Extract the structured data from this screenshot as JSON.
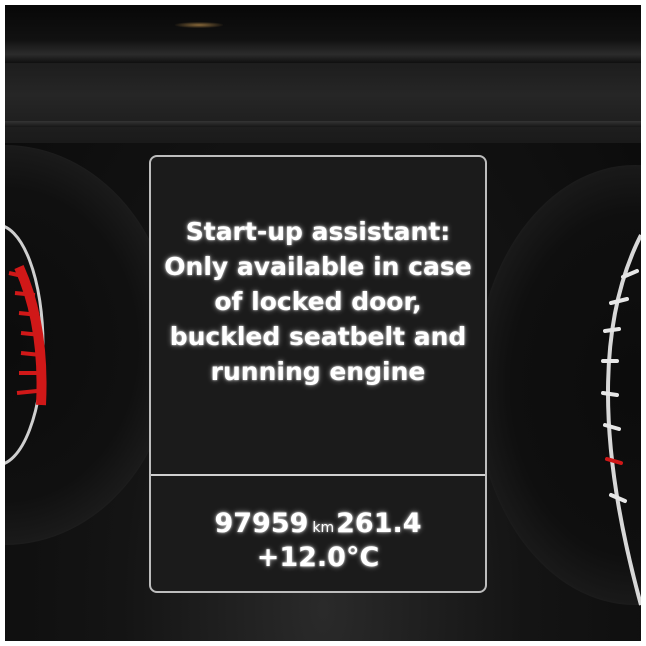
{
  "message": {
    "lines": [
      "Start-up assistant:",
      "Only available in case",
      "of locked door,",
      "buckled seatbelt and",
      "running engine"
    ]
  },
  "status": {
    "odometer": "97959",
    "odometer_unit": "km",
    "trip": "261.4",
    "temperature": "+12.0°C"
  },
  "colors": {
    "display_background": "#1b1b1b",
    "display_border": "#bdbdbd",
    "text": "#ffffff",
    "redline": "#d01818"
  },
  "icons": {
    "left_gauge": "tachometer-gauge",
    "right_gauge": "speedometer-gauge"
  }
}
